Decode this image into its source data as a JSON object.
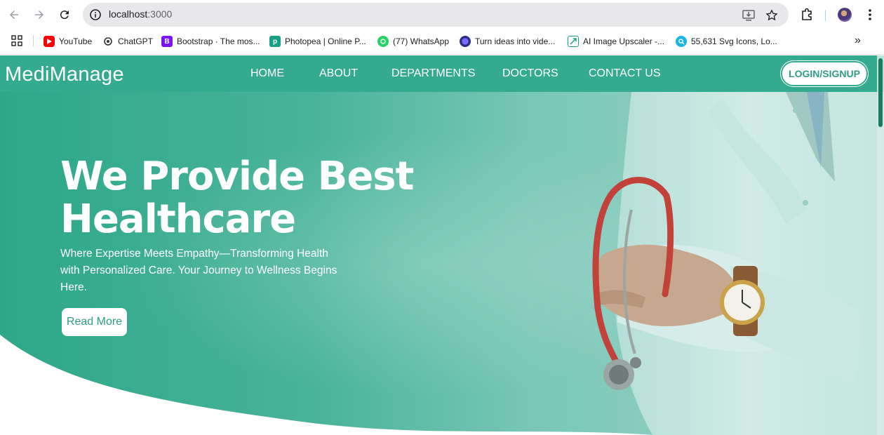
{
  "browser": {
    "url_host": "localhost",
    "url_port": ":3000",
    "bookmarks": [
      {
        "label": "YouTube",
        "icon": "youtube-icon"
      },
      {
        "label": "ChatGPT",
        "icon": "chatgpt-icon"
      },
      {
        "label": "Bootstrap · The mos...",
        "icon": "bootstrap-icon"
      },
      {
        "label": "Photopea | Online P...",
        "icon": "photopea-icon"
      },
      {
        "label": "(77) WhatsApp",
        "icon": "whatsapp-icon"
      },
      {
        "label": "Turn ideas into vide...",
        "icon": "video-ai-icon"
      },
      {
        "label": "AI Image Upscaler -...",
        "icon": "upscaler-icon"
      },
      {
        "label": "55,631 Svg Icons, Lo...",
        "icon": "svg-icons-icon"
      }
    ],
    "more_bookmarks": "»"
  },
  "site": {
    "brand": "MediManage",
    "nav": [
      "HOME",
      "ABOUT",
      "DEPARTMENTS",
      "DOCTORS",
      "CONTACT US"
    ],
    "login_label": "LOGIN/SIGNUP"
  },
  "hero": {
    "title_line1": "We Provide Best",
    "title_line2": "Healthcare",
    "subtitle": "Where Expertise Meets Empathy—Transforming Health with Personalized Care. Your Journey to Wellness Begins Here.",
    "cta_label": "Read More"
  },
  "colors": {
    "brand_teal": "#34ab91",
    "button_text": "#2e9d84"
  }
}
